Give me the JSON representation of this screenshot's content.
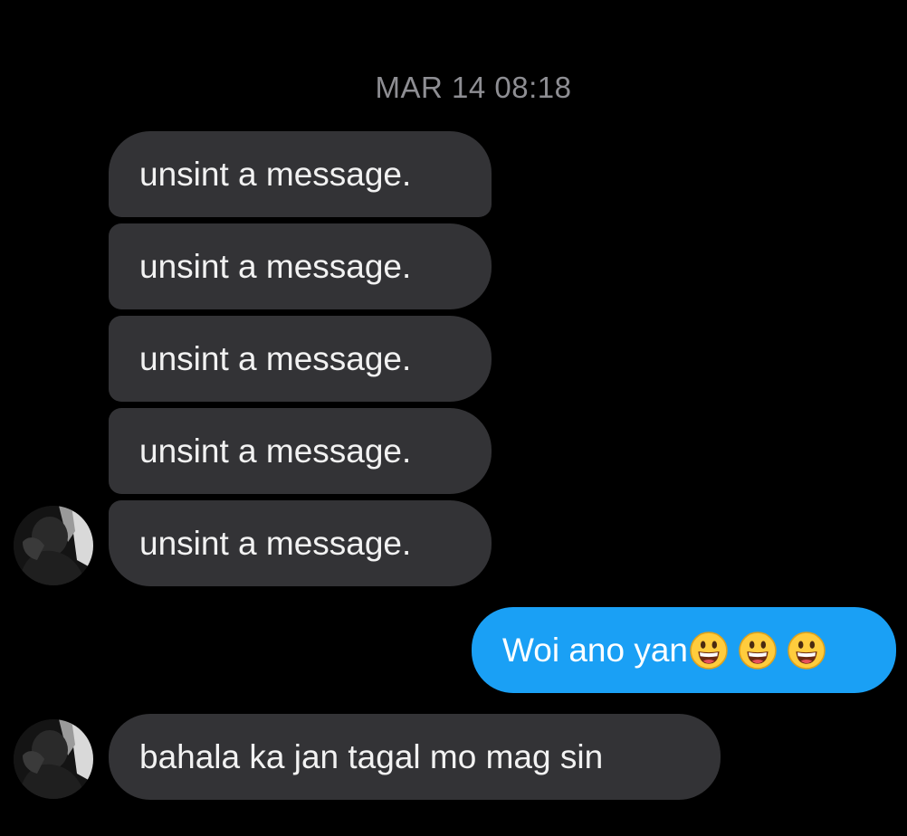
{
  "conversation": {
    "timestamp": "MAR 14 08:18",
    "incoming_group": [
      {
        "text": "unsint a message."
      },
      {
        "text": "unsint a message."
      },
      {
        "text": "unsint a message."
      },
      {
        "text": "unsint a message."
      },
      {
        "text": "unsint a message."
      }
    ],
    "outgoing": {
      "text": "Woi ano yan",
      "emojis": [
        "grinning-face-emoji",
        "grinning-face-emoji",
        "grinning-face-emoji"
      ]
    },
    "incoming_last": {
      "text": "bahala ka jan tagal mo mag sin"
    }
  },
  "colors": {
    "background": "#000000",
    "incoming_bubble": "#333336",
    "outgoing_bubble": "#1aa0f5",
    "timestamp_text": "#8e8e93"
  }
}
